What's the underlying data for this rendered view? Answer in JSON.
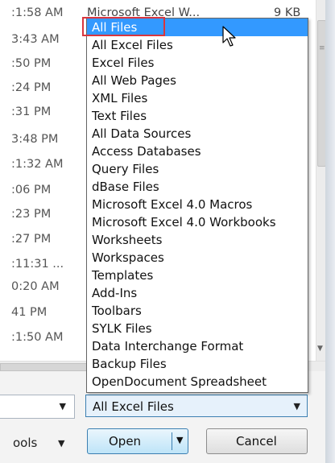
{
  "file_rows": [
    {
      "time": ":1:58 AM",
      "type": "Microsoft Excel W...",
      "size": "9 KB"
    },
    {
      "time": "3:43 AM"
    },
    {
      "time": ":50 PM"
    },
    {
      "time": ":24 PM"
    },
    {
      "time": ":31 PM"
    },
    {
      "time": "3:48 PM"
    },
    {
      "time": ":1:32 AM"
    },
    {
      "time": ":06 PM"
    },
    {
      "time": ":23 PM"
    },
    {
      "time": ":27 PM"
    },
    {
      "time": ":11:31 ..."
    },
    {
      "time": "0:20 AM"
    },
    {
      "time": "41 PM"
    },
    {
      "time": ":1:50 AM"
    }
  ],
  "file_type_dropdown": {
    "options": [
      "All Files",
      "All Excel Files",
      "Excel Files",
      "All Web Pages",
      "XML Files",
      "Text Files",
      "All Data Sources",
      "Access Databases",
      "Query Files",
      "dBase Files",
      "Microsoft Excel 4.0 Macros",
      "Microsoft Excel 4.0 Workbooks",
      "Worksheets",
      "Workspaces",
      "Templates",
      "Add-Ins",
      "Toolbars",
      "SYLK Files",
      "Data Interchange Format",
      "Backup Files",
      "OpenDocument Spreadsheet"
    ],
    "highlighted": "All Files",
    "selected_value": "All Excel Files"
  },
  "bottom": {
    "tools_label": "ools",
    "open_label": "Open",
    "cancel_label": "Cancel"
  },
  "icons": {
    "dropdown_arrow": "chevron-down-icon",
    "cursor": "mouse-pointer-icon"
  },
  "colors": {
    "selection": "#3399ff",
    "highlight_box": "#d9363e",
    "accent_border": "#3c7fb1"
  }
}
